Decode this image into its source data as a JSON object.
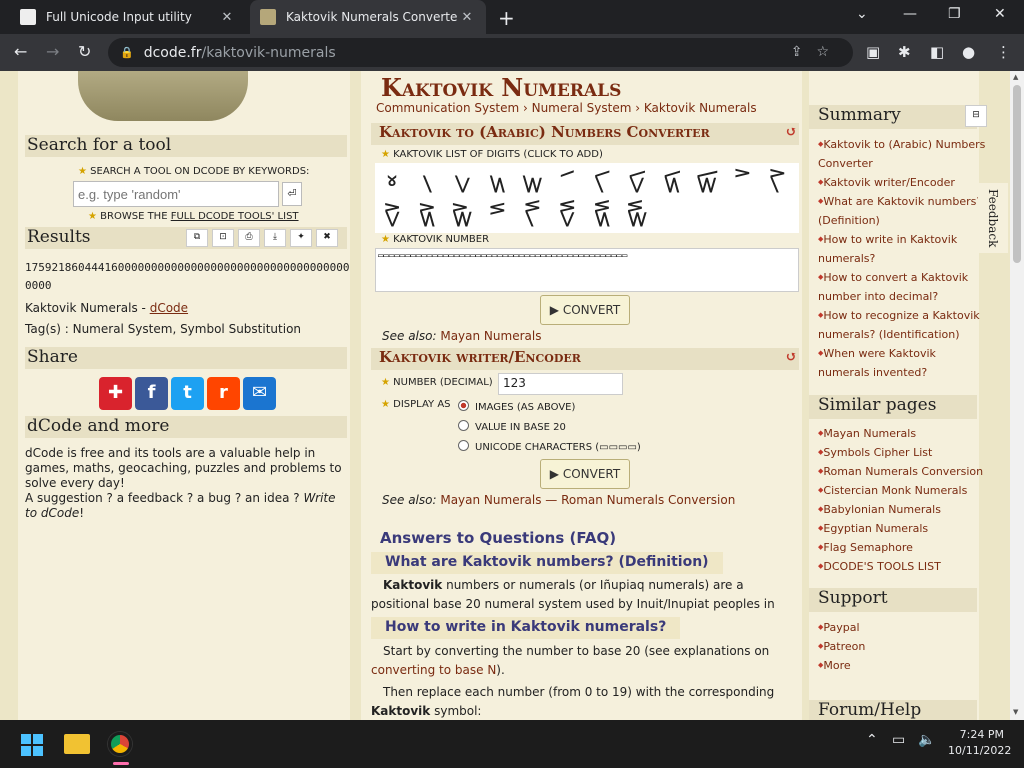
{
  "browser": {
    "tab1_title": "Full Unicode Input utility",
    "tab2_title": "Kaktovik Numerals Converter - O",
    "url_domain": "dcode.fr",
    "url_path": "/kaktovik-numerals",
    "new_tab": "+",
    "tab_close": "✕",
    "win_min": "⌄",
    "win_restore": "—",
    "win_max": "❐",
    "win_close": "✕"
  },
  "left": {
    "search_title": "Search for a tool",
    "search_hint": "SEARCH A TOOL ON DCODE BY KEYWORDS:",
    "search_placeholder": "e.g. type 'random'",
    "browse_prefix": "BROWSE THE ",
    "browse_link": "FULL DCODE TOOLS' LIST",
    "results_title": "Results",
    "result_value": "17592186044416000000000000000000000000000000000000000",
    "result_tool": "Kaktovik Numerals - ",
    "result_tool_link": "dCode",
    "result_tags": "Tag(s) : Numeral System, Symbol Substitution",
    "share_title": "Share",
    "more_title": "dCode and more",
    "more_text": "dCode is free and its tools are a valuable help in games, maths, geocaching, puzzles and problems to solve every day!",
    "more_text2": "A suggestion ? a feedback ? a bug ? an idea ? ",
    "more_link": "Write to dCode",
    "more_end": "!"
  },
  "main": {
    "page_title": "Kaktovik Numerals",
    "breadcrumb": [
      "Communication System",
      "Numeral System",
      "Kaktovik Numerals"
    ],
    "sec1_title": "Kaktovik to (Arabic) Numbers Converter",
    "digits_label": "KAKTOVIK LIST OF DIGITS (CLICK TO ADD)",
    "digits": [
      "𝋀",
      "𝋁",
      "𝋂",
      "𝋃",
      "𝋄",
      "𝋅",
      "𝋆",
      "𝋇",
      "𝋈",
      "𝋉",
      "𝋊",
      "𝋋",
      "𝋌",
      "𝋍",
      "𝋎",
      "𝋏",
      "𝋐",
      "𝋑",
      "𝋒",
      "𝋓"
    ],
    "number_label": "KAKTOVIK NUMBER",
    "number_value": "▭▭▭▭▭▭▭▭▭▭▭▭▭▭▭▭▭▭▭▭▭▭▭▭▭▭▭▭▭▭▭▭▭▭▭▭▭▭▭▭▭▭▭▭▭▭",
    "convert_label": "▶ CONVERT",
    "see_also1_prefix": "See also: ",
    "see_also1": "Mayan Numerals",
    "sec2_title": "Kaktovik writer/Encoder",
    "decimal_label": "NUMBER (DECIMAL)",
    "decimal_value": "123",
    "display_label": "DISPLAY AS",
    "opt1": "IMAGES (AS ABOVE)",
    "opt2": "VALUE IN BASE 20",
    "opt3": "UNICODE CHARACTERS (▭▭▭▭)",
    "see_also2_prefix": "See also: ",
    "see_also2": "Mayan Numerals — Roman Numerals Conversion",
    "faq_title": "Answers to Questions (FAQ)",
    "faq1": "What are Kaktovik numbers? (Definition)",
    "faq1_bold": "Kaktovik",
    "faq1_text": " numbers or numerals (or Iñupiaq numerals) are a positional base 20 numeral system used by Inuit/Inupiat peoples in Alaska and Canada.",
    "faq2": "How to write in Kaktovik numerals?",
    "faq2_text": "Start by converting the number to base 20 (see explanations on ",
    "faq2_link": "converting to base N",
    "faq2_end": ").",
    "faq2_text2": "Then replace each number (from 0 to 19) with the corresponding",
    "faq2_bold": "Kaktovik",
    "faq2_text3": " symbol:"
  },
  "right": {
    "summary_title": "Summary",
    "summary": [
      "Kaktovik to (Arabic) Numbers Converter",
      "Kaktovik writer/Encoder",
      "What are Kaktovik numbers? (Definition)",
      "How to write in Kaktovik numerals?",
      "How to convert a Kaktovik number into decimal?",
      "How to recognize a Kaktovik numerals? (Identification)",
      "When were Kaktovik numerals invented?"
    ],
    "similar_title": "Similar pages",
    "similar": [
      "Mayan Numerals",
      "Symbols Cipher List",
      "Roman Numerals Conversion",
      "Cistercian Monk Numerals",
      "Babylonian Numerals",
      "Egyptian Numerals",
      "Flag Semaphore",
      "DCODE'S TOOLS LIST"
    ],
    "support_title": "Support",
    "support": [
      "Paypal",
      "Patreon",
      "More"
    ],
    "forum_title": "Forum/Help",
    "feedback": "Feedback"
  },
  "taskbar": {
    "time": "7:24 PM",
    "date": "10/11/2022"
  }
}
